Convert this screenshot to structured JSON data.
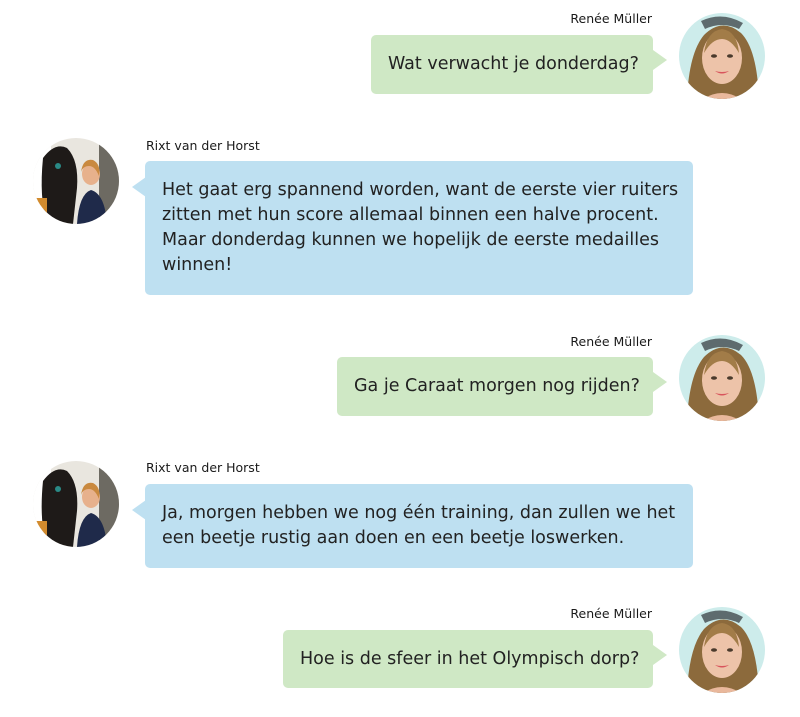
{
  "participants": {
    "interviewer": {
      "name": "Renée Müller",
      "avatar_icon": "woman-portrait-icon"
    },
    "interviewee": {
      "name": "Rixt van der Horst",
      "avatar_icon": "rider-with-horse-portrait-icon"
    }
  },
  "colors": {
    "outgoing_bubble": "#cfe8c5",
    "incoming_bubble": "#bee0f1",
    "text": "#222222"
  },
  "messages": [
    {
      "sender": "Renée Müller",
      "direction": "outgoing",
      "text": "Wat verwacht je donderdag?"
    },
    {
      "sender": "Rixt van der Horst",
      "direction": "incoming",
      "text": "Het gaat erg spannend worden, want de eerste vier ruiters zitten met hun score allemaal binnen een halve procent. Maar donderdag kunnen we hopelijk de eerste medailles winnen!"
    },
    {
      "sender": "Renée Müller",
      "direction": "outgoing",
      "text": "Ga je Caraat morgen nog rijden?"
    },
    {
      "sender": "Rixt van der Horst",
      "direction": "incoming",
      "text": "Ja, morgen hebben we nog één training, dan zullen we het een beetje rustig aan doen en een beetje loswerken."
    },
    {
      "sender": "Renée Müller",
      "direction": "outgoing",
      "text": "Hoe is de sfeer in het Olympisch dorp?"
    }
  ]
}
